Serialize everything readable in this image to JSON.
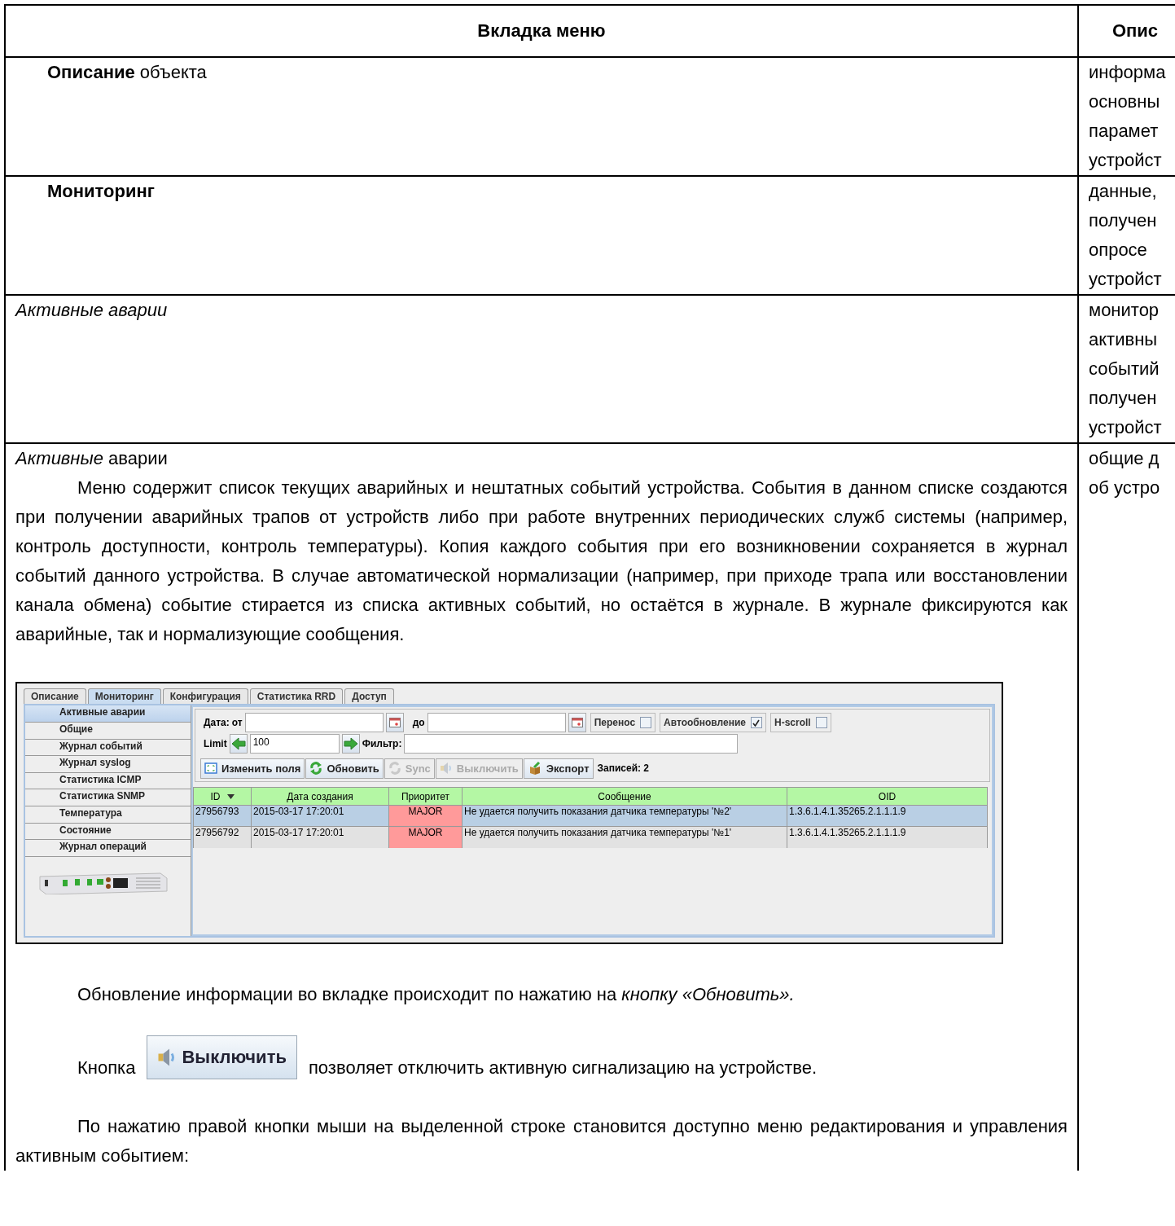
{
  "table": {
    "columns": [
      "Вкладка меню",
      "Опис"
    ],
    "rows": [
      {
        "title": "**Описание** объекта",
        "bold": false,
        "italic": false,
        "indented": true,
        "description": [
          "информа",
          "основны",
          "парамет",
          "устройст"
        ]
      },
      {
        "title": "Мониторинг",
        "bold": true,
        "italic": false,
        "indented": true,
        "description": [
          "данные,",
          "получен",
          "опросе",
          "устройст"
        ]
      },
      {
        "title": "Активные аварии",
        "bold": false,
        "italic": true,
        "indented": false,
        "description": [
          "монитор",
          "активны",
          "событий",
          "получен",
          "устройст"
        ]
      },
      {
        "title": "*Активные* аварии",
        "bold": false,
        "italic": false,
        "indented": false,
        "description": [
          "общие д",
          "об устро"
        ],
        "intro": "Меню содержит список текущих аварийных и нештатных событий устройства. События в данном списке создаются при получении аварийных трапов от устройств либо при работе внутренних периодических служб системы (например, контроль доступности, контроль температуры). Копия каждого события при его возникновении сохраняется в журнал событий данного устройства. В случае автоматической нормализации (например, при приходе трапа или восстановлении канала обмена) событие стирается из списка активных событий, но остаётся в журнале. В журнале фиксируются как аварийные, так и нормализующие сообщения.",
        "app": {
          "tabs": [
            {
              "label": "Описание",
              "selected": false
            },
            {
              "label": "Мониторинг",
              "selected": true
            },
            {
              "label": "Конфигурация",
              "selected": false
            },
            {
              "label": "Статистика RRD",
              "selected": false
            },
            {
              "label": "Доступ",
              "selected": false
            }
          ],
          "menu": [
            {
              "label": "Активные аварии",
              "selected": true
            },
            {
              "label": "Общие",
              "selected": false
            },
            {
              "label": "Журнал событий",
              "selected": false
            },
            {
              "label": "Журнал syslog",
              "selected": false
            },
            {
              "label": "Статистика ICMP",
              "selected": false
            },
            {
              "label": "Статистика SNMP",
              "selected": false
            },
            {
              "label": "Температура",
              "selected": false
            },
            {
              "label": "Состояние",
              "selected": false
            },
            {
              "label": "Журнал операций",
              "selected": false
            }
          ],
          "date_label": "Дата:",
          "from_label": "от",
          "to_label": "до",
          "checkboxes": [
            {
              "label": "Перенос",
              "checked": false
            },
            {
              "label": "Автообновление",
              "checked": true
            },
            {
              "label": "H-scroll",
              "checked": false
            }
          ],
          "limit_label": "Limit",
          "limit_value": "100",
          "filter_label": "Фильтр:",
          "buttons": [
            {
              "label": "Изменить поля",
              "disabled": false
            },
            {
              "label": "Обновить",
              "disabled": false
            },
            {
              "label": "Sync",
              "disabled": true
            },
            {
              "label": "Выключить",
              "disabled": true
            },
            {
              "label": "Экспорт",
              "disabled": false
            }
          ],
          "records": "Записей: 2",
          "columns": [
            {
              "label": "ID",
              "sorted": true
            },
            {
              "label": "Дата создания",
              "sorted": false
            },
            {
              "label": "Приоритет",
              "sorted": false
            },
            {
              "label": "Сообщение",
              "sorted": false
            },
            {
              "label": "OID",
              "sorted": false
            }
          ],
          "rows": [
            {
              "cells": [
                "27956793",
                "2015-03-17 17:20:01",
                "MAJOR",
                "Не удается получить показания датчика температуры '№2'",
                "1.3.6.1.4.1.35265.2.1.1.1.9"
              ],
              "selected": true
            },
            {
              "cells": [
                "27956792",
                "2015-03-17 17:20:01",
                "MAJOR",
                "Не удается получить показания датчика температуры '№1'",
                "1.3.6.1.4.1.35265.2.1.1.1.9"
              ],
              "selected": false
            }
          ]
        },
        "refresh_note": "Обновление информации во вкладке происходит по нажатию на *кнопку «Обновить».*",
        "button_note": {
          "before": "Кнопка",
          "button": "Выключить",
          "after": "позволяет отключить активную сигнализацию на устройстве."
        },
        "menu_note": "По нажатию правой кнопки мыши на выделенной строке становится доступно меню редактирования и управления активным событием:"
      }
    ]
  }
}
